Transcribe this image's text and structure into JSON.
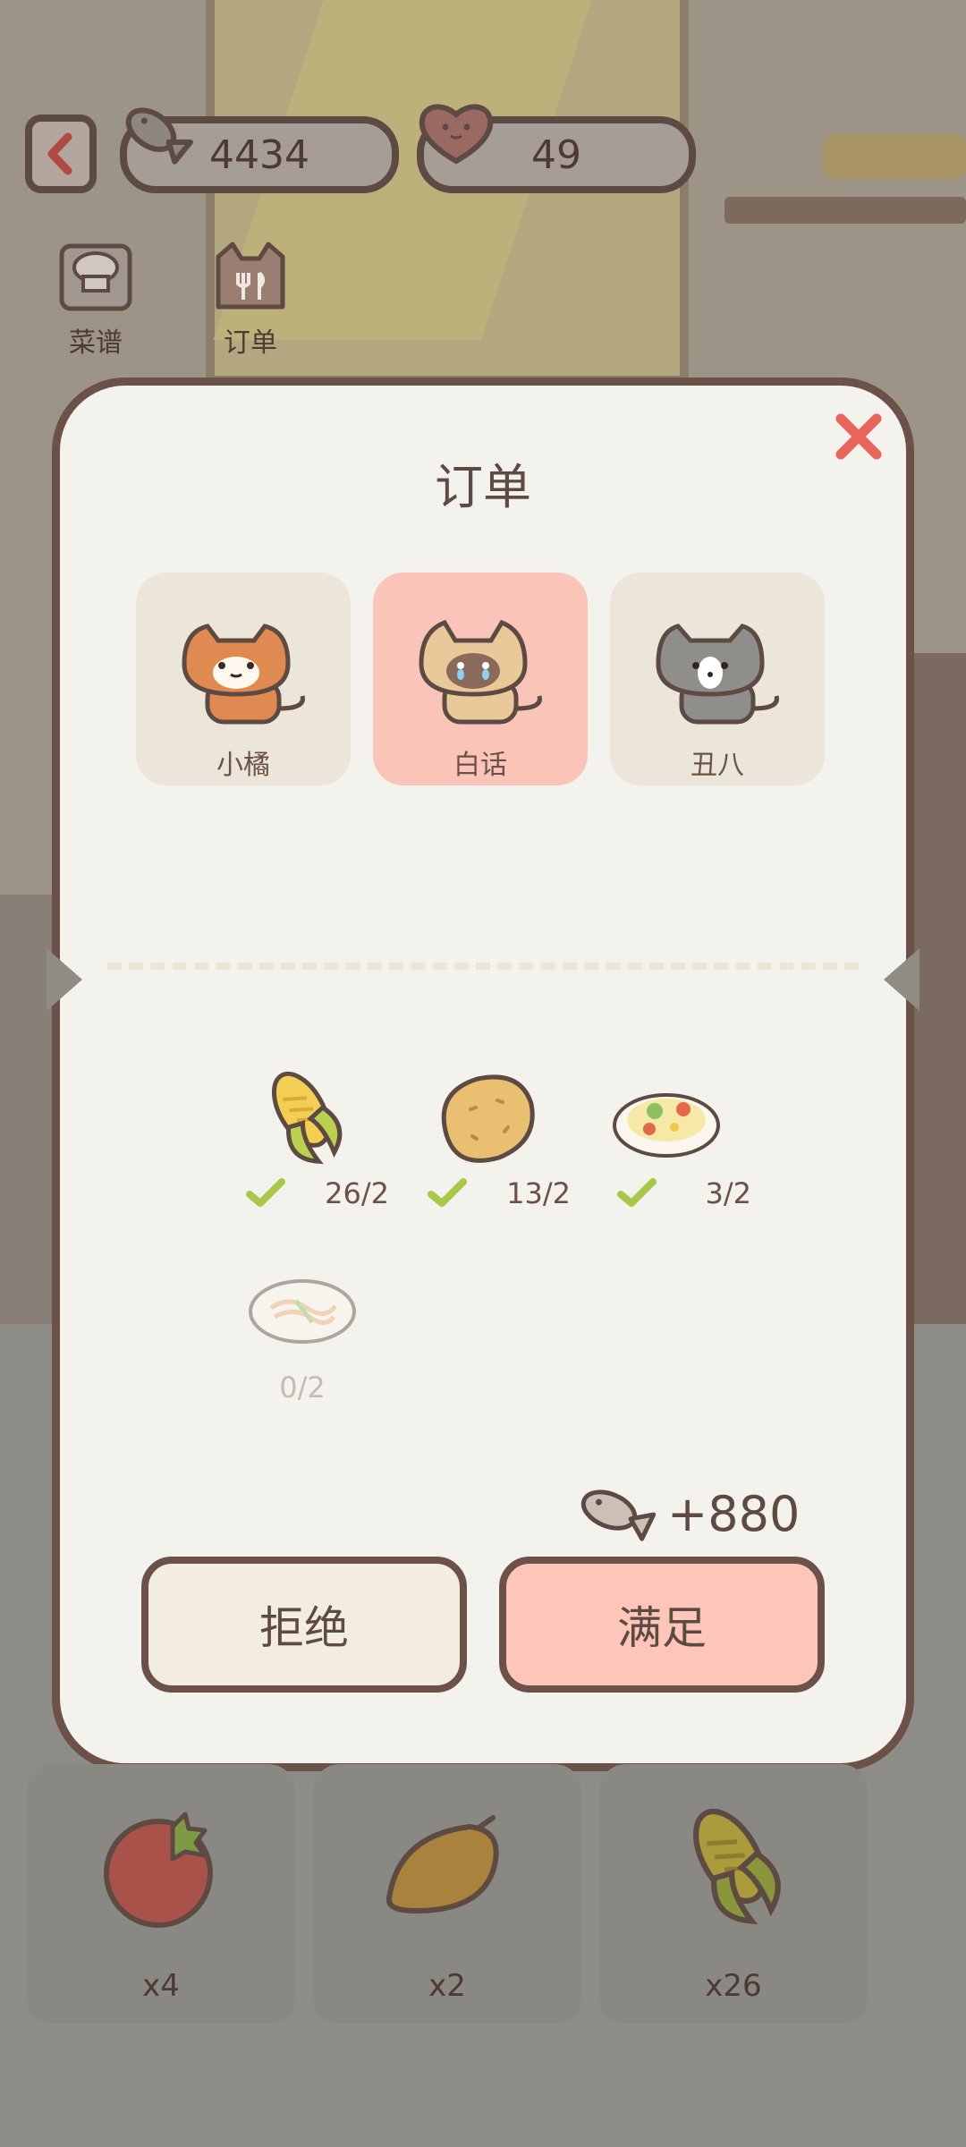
{
  "hud": {
    "fish_count": "4434",
    "heart_count": "49"
  },
  "nav": {
    "recipes_label": "菜谱",
    "orders_label": "订单"
  },
  "modal": {
    "title": "订单",
    "cats": [
      {
        "name": "小橘",
        "selected": false
      },
      {
        "name": "白话",
        "selected": true
      },
      {
        "name": "丑八",
        "selected": false
      }
    ],
    "dishes": [
      {
        "icon": "corn-icon",
        "progress": "26/2",
        "complete": true
      },
      {
        "icon": "potato-icon",
        "progress": "13/2",
        "complete": true
      },
      {
        "icon": "fried-rice-icon",
        "progress": "3/2",
        "complete": true
      },
      {
        "icon": "noodles-icon",
        "progress": "0/2",
        "complete": false
      }
    ],
    "reward": "+880",
    "reject_label": "拒绝",
    "accept_label": "满足"
  },
  "inventory": [
    {
      "icon": "tomato-icon",
      "count": "x4"
    },
    {
      "icon": "mango-icon",
      "count": "x2"
    },
    {
      "icon": "corn-icon",
      "count": "x26"
    }
  ],
  "colors": {
    "accent_pink": "#fdc6b9",
    "outline_brown": "#6b5147",
    "check_green": "#a8c84a",
    "close_red": "#e8645c"
  }
}
